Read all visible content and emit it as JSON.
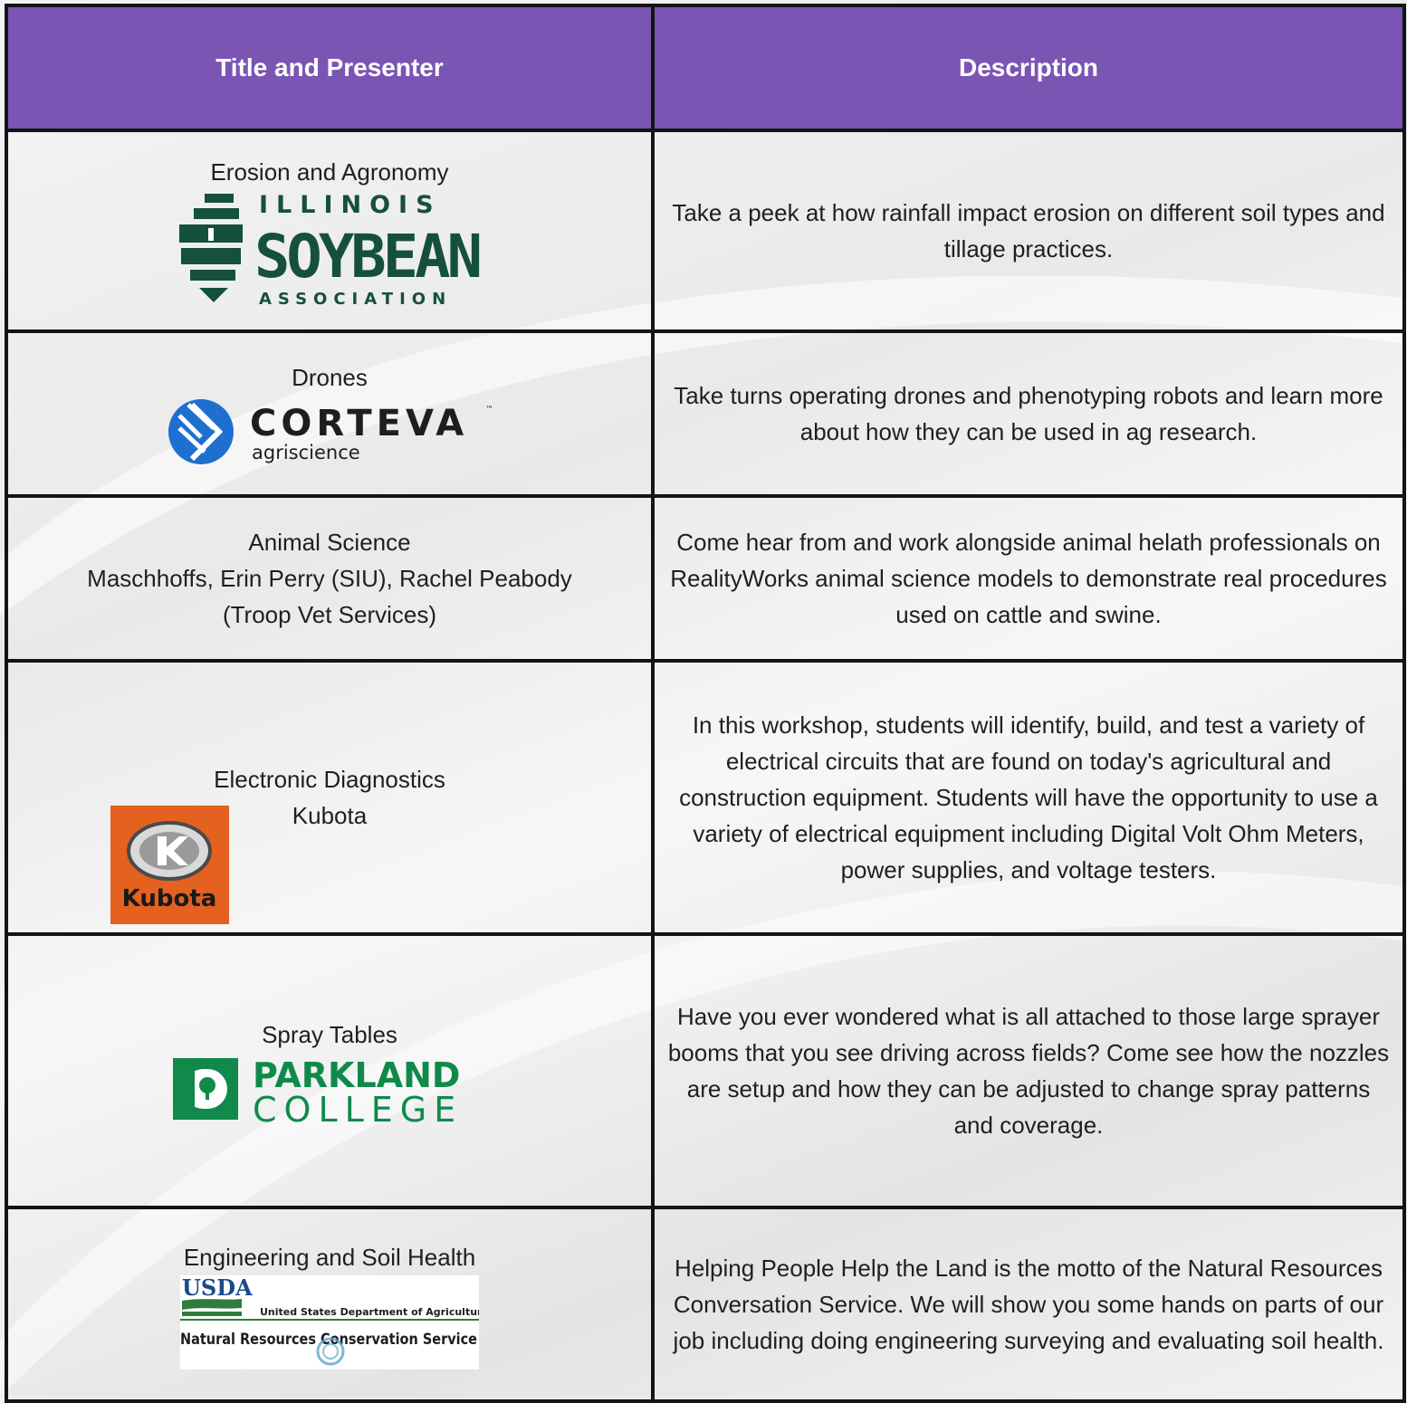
{
  "header": {
    "col1": "Title and Presenter",
    "col2": "Description"
  },
  "rows": [
    {
      "title": "Erosion and Agronomy",
      "logo": {
        "name": "illinois-soybean-logo",
        "line1": "ILLINOIS",
        "line2": "SOYBEAN",
        "line3": "ASSOCIATION",
        "color": "#15513a"
      },
      "description": "Take a peek at how rainfall impact erosion on different soil types and tillage practices."
    },
    {
      "title": "Drones",
      "logo": {
        "name": "corteva-logo",
        "line1": "CORTEVA",
        "tm": "™",
        "line2": "agriscience",
        "color": "#1f6fd1"
      },
      "description": "Take turns operating drones and phenotyping robots and learn more about how they can be used in ag research."
    },
    {
      "title": "Animal Science",
      "presenter": "Maschhoffs, Erin Perry (SIU), Rachel Peabody (Troop Vet Services)",
      "description": "Come hear from and work alongside animal helath professionals on RealityWorks animal science models to demonstrate real procedures used on cattle and swine."
    },
    {
      "title": "Electronic Diagnostics",
      "presenter": "Kubota",
      "logo": {
        "name": "kubota-logo",
        "text": "Kubota",
        "color": "#e4611f"
      },
      "description": "In this workshop, students will identify, build, and test a variety of electrical circuits that are found on today's agricultural and construction equipment. Students will have the opportunity to use a variety of electrical equipment including Digital Volt Ohm Meters, power supplies, and voltage testers."
    },
    {
      "title": "Spray Tables",
      "logo": {
        "name": "parkland-college-logo",
        "line1": "PARKLAND",
        "line2": "COLLEGE",
        "color": "#0f8a4a"
      },
      "description": "Have you ever wondered what is all attached to those large sprayer booms that you see driving across fields? Come see how the nozzles are setup and how they can be adjusted to change spray patterns and coverage."
    },
    {
      "title": "Engineering and Soil Health",
      "logo": {
        "name": "usda-nrcs-logo",
        "line1": "USDA",
        "line2": "United States Department of Agriculture",
        "line3": "Natural Resources Conservation Service",
        "color": "#1a4a8a"
      },
      "description": "Helping People Help the Land is the motto of the Natural Resources Conversation Service. We will show you some hands on parts of our job including doing engineering surveying and evaluating soil health."
    }
  ],
  "colors": {
    "header_bg": "#7a55b4",
    "border": "#141414"
  }
}
